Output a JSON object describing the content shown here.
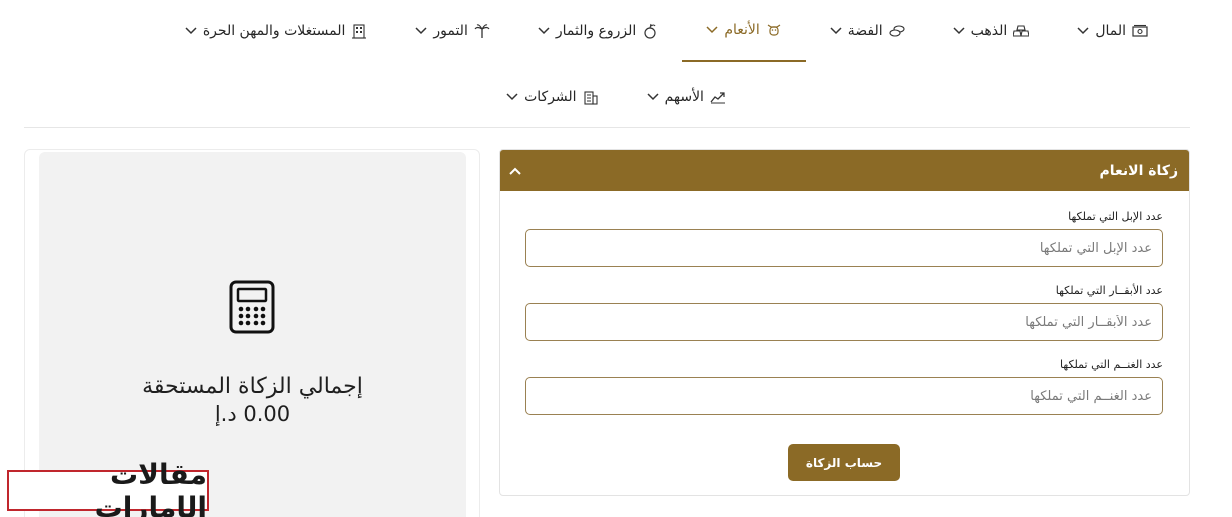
{
  "nav": {
    "row1": [
      {
        "label": "المال",
        "icon": "money-icon"
      },
      {
        "label": "الذهب",
        "icon": "gold-bars-icon"
      },
      {
        "label": "الفضة",
        "icon": "silver-coins-icon"
      },
      {
        "label": "الأنعام",
        "icon": "cow-icon"
      },
      {
        "label": "الزروع والثمار",
        "icon": "fruit-icon"
      },
      {
        "label": "التمور",
        "icon": "palm-tree-icon"
      },
      {
        "label": "المستغلات والمهن الحرة",
        "icon": "building-icon"
      }
    ],
    "row2": [
      {
        "label": "الأسهم",
        "icon": "stocks-chart-icon"
      },
      {
        "label": "الشركات",
        "icon": "company-building-icon"
      }
    ],
    "active": "الأنعام"
  },
  "form": {
    "title": "زكاة الانعام",
    "fields": [
      {
        "label": "عدد الإبل التي تملكها",
        "placeholder": "عدد الإبل التي تملكها",
        "value": ""
      },
      {
        "label": "عدد الأبقــار التي تملكها",
        "placeholder": "عدد الأبقــار التي تملكها",
        "value": ""
      },
      {
        "label": "عدد الغنــم التي تملكها",
        "placeholder": "عدد الغنــم التي تملكها",
        "value": ""
      }
    ],
    "submit_label": "حساب الزكاة"
  },
  "summary": {
    "label": "إجمالي الزكاة المستحقة",
    "value": "0.00 د.إ",
    "icon": "calculator-icon"
  },
  "watermark": {
    "text": "مقالات الإمارات"
  },
  "colors": {
    "accent": "#8b6a26",
    "border": "#9a8152",
    "panel": "#f2f2f2",
    "watermark_border": "#c0262d"
  }
}
